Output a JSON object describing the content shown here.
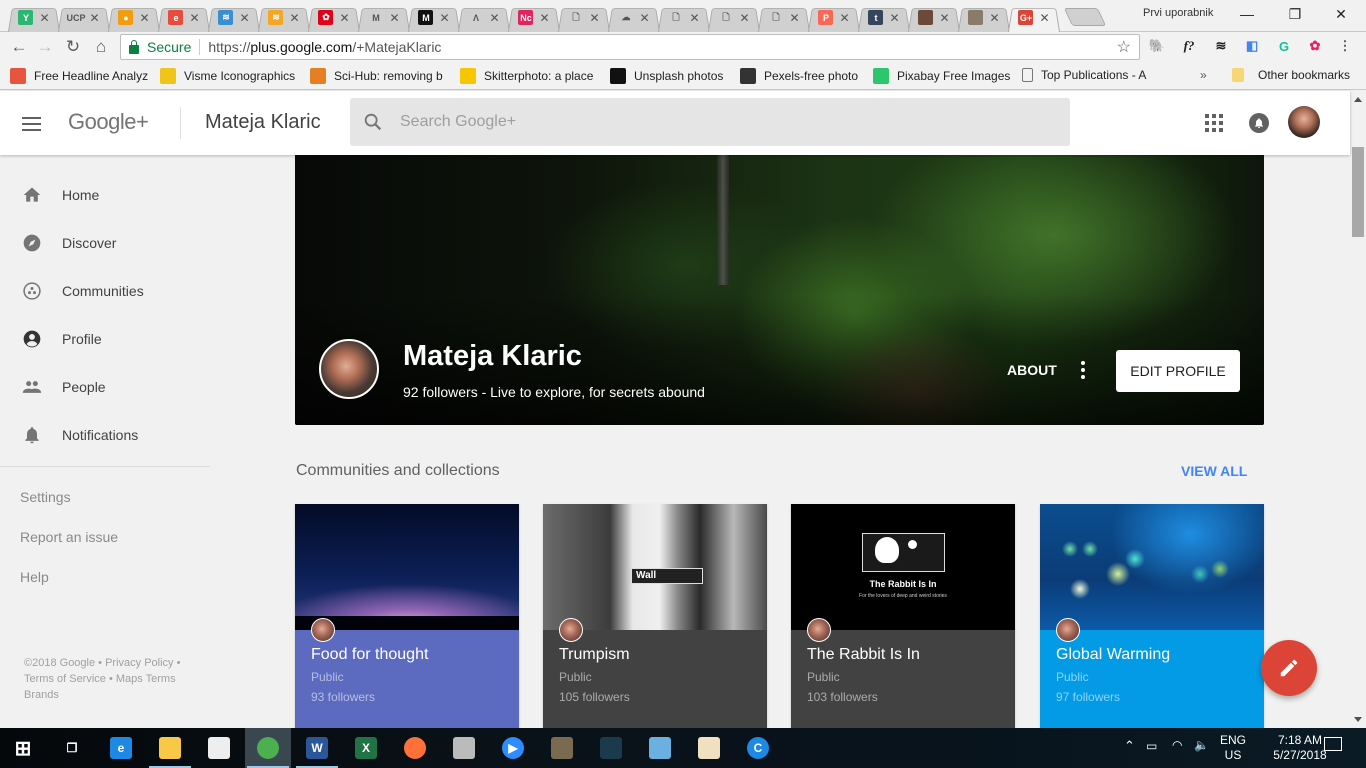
{
  "browser": {
    "tabs": [
      {
        "icon": "y-combinator-icon",
        "color": "#2bb673",
        "glyph": "Y"
      },
      {
        "icon": "ucp-icon",
        "color": "transparent",
        "glyph": "UCP"
      },
      {
        "icon": "speech-bubble-icon",
        "color": "#f39c12",
        "glyph": "●"
      },
      {
        "icon": "e-book-icon",
        "color": "#e74c3c",
        "glyph": "e"
      },
      {
        "icon": "rays-blue-icon",
        "color": "#3a8fd4",
        "glyph": "≋"
      },
      {
        "icon": "rays-orange-icon",
        "color": "#f5a623",
        "glyph": "≋"
      },
      {
        "icon": "huawei-icon",
        "color": "#e1001a",
        "glyph": "✿"
      },
      {
        "icon": "gmail-icon",
        "color": "transparent",
        "glyph": "M"
      },
      {
        "icon": "medium-icon",
        "color": "#111",
        "glyph": "M"
      },
      {
        "icon": "arrow-a-icon",
        "color": "transparent",
        "glyph": "Λ"
      },
      {
        "icon": "nc-icon",
        "color": "#e0245e",
        "glyph": "Nc"
      },
      {
        "icon": "document-icon",
        "color": "transparent",
        "glyph": "🗋"
      },
      {
        "icon": "jellyfish-icon",
        "color": "transparent",
        "glyph": "☁"
      },
      {
        "icon": "document-icon",
        "color": "transparent",
        "glyph": "🗋"
      },
      {
        "icon": "document-icon",
        "color": "transparent",
        "glyph": "🗋"
      },
      {
        "icon": "document-icon",
        "color": "transparent",
        "glyph": "🗋"
      },
      {
        "icon": "patreon-icon",
        "color": "#f96854",
        "glyph": "P"
      },
      {
        "icon": "tumblr-icon",
        "color": "#35465c",
        "glyph": "t"
      },
      {
        "icon": "avatar-icon",
        "color": "#6b4a3c",
        "glyph": ""
      },
      {
        "icon": "photo-icon",
        "color": "#8a7a6a",
        "glyph": ""
      },
      {
        "icon": "google-plus-icon",
        "color": "#db4437",
        "glyph": "G+",
        "active": true
      }
    ],
    "profile_name": "Prvi uporabnik",
    "address": {
      "secure_label": "Secure",
      "url_prefix": "https://",
      "url_host": "plus.google.com",
      "url_path": "/+MatejaKlaric"
    },
    "bookmarks": [
      {
        "label": "Free Headline Analyz",
        "icon": "checkmark-icon",
        "color": "#e8553e"
      },
      {
        "label": "Visme Iconographics",
        "icon": "pencil-icon",
        "color": "#f0c419"
      },
      {
        "label": "Sci-Hub: removing b",
        "icon": "scihub-eye-icon",
        "color": "#e67e22"
      },
      {
        "label": "Skitterphoto: a place",
        "icon": "skitterphoto-icon",
        "color": "#f7c600"
      },
      {
        "label": "Unsplash photos",
        "icon": "camera-icon",
        "color": "#111"
      },
      {
        "label": "Pexels-free photo",
        "icon": "pexels-icon",
        "color": "#333"
      },
      {
        "label": "Pixabay Free Images",
        "icon": "pixabay-icon",
        "color": "#2ec66d"
      },
      {
        "label": "Top Publications - A",
        "icon": "document-icon",
        "color": "transparent"
      }
    ],
    "bookmarks_overflow": "»",
    "other_bookmarks": "Other bookmarks"
  },
  "header": {
    "logo": "Google+",
    "title": "Mateja Klaric",
    "search_placeholder": "Search Google+"
  },
  "sidebar": {
    "items": [
      {
        "label": "Home",
        "icon": "home-icon"
      },
      {
        "label": "Discover",
        "icon": "compass-icon"
      },
      {
        "label": "Communities",
        "icon": "communities-icon"
      },
      {
        "label": "Profile",
        "icon": "profile-icon",
        "active": true
      },
      {
        "label": "People",
        "icon": "people-icon"
      },
      {
        "label": "Notifications",
        "icon": "bell-icon"
      }
    ],
    "secondary": [
      "Settings",
      "Report an issue",
      "Help"
    ],
    "legal": {
      "copyright": "©2018 Google",
      "privacy": "Privacy Policy",
      "terms": "Terms of Service",
      "maps": "Maps Terms",
      "brands": "Brands"
    }
  },
  "profile": {
    "name": "Mateja Klaric",
    "tagline": "92 followers - Live to explore, for secrets abound",
    "about_label": "ABOUT",
    "edit_label": "EDIT PROFILE"
  },
  "communities": {
    "title": "Communities and collections",
    "view_all": "VIEW ALL",
    "cards": [
      {
        "name": "Food for thought",
        "visibility": "Public",
        "followers": "93 followers",
        "color": "#5c6bc0"
      },
      {
        "name": "Trumpism",
        "visibility": "Public",
        "followers": "105 followers",
        "color": "#424242"
      },
      {
        "name": "The Rabbit Is In",
        "visibility": "Public",
        "followers": "103 followers",
        "color": "#424242",
        "image_title": "The Rabbit Is In",
        "image_subtitle": "For the lovers of deep and weird stories"
      },
      {
        "name": "Global Warming",
        "visibility": "Public",
        "followers": "97 followers",
        "color": "#039be5"
      }
    ],
    "wall_sign": "Wall"
  },
  "taskbar": {
    "apps": [
      "windows-start-icon",
      "task-view-icon",
      "edge-icon",
      "file-explorer-icon",
      "calculator-icon",
      "chrome-icon",
      "word-icon",
      "excel-icon",
      "firefox-icon",
      "scanner-icon",
      "zoom-icon",
      "gimp-icon",
      "kindle-icon",
      "paint-3d-icon",
      "paint-icon",
      "ccleaner-icon"
    ],
    "language": "ENG",
    "region": "US",
    "time": "7:18 AM",
    "date": "5/27/2018"
  }
}
